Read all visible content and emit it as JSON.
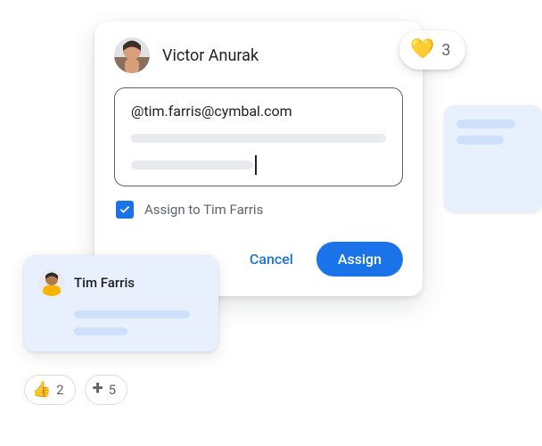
{
  "dialog": {
    "author_name": "Victor Anurak",
    "mention_text": "@tim.farris@cymbal.com",
    "assign_label": "Assign to Tim Farris",
    "assign_checked": true,
    "actions": {
      "cancel": "Cancel",
      "assign": "Assign"
    }
  },
  "heart_reaction": {
    "emoji": "💛",
    "count": "3"
  },
  "mini_card": {
    "name": "Tim Farris"
  },
  "reactions": {
    "thumbs": {
      "emoji": "👍",
      "count": "2"
    },
    "plus": {
      "glyph": "+",
      "count": "5"
    }
  }
}
